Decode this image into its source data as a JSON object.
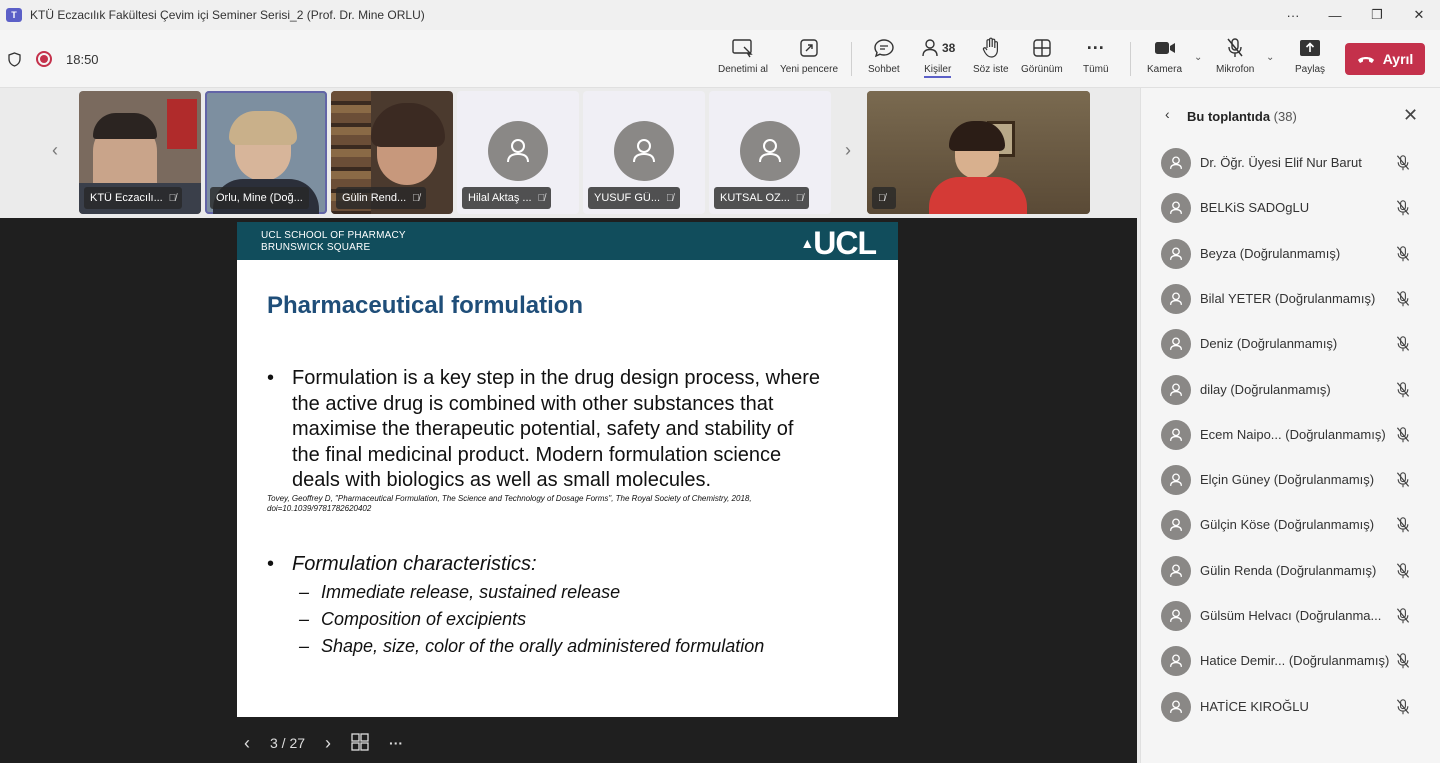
{
  "window": {
    "app_icon_text": "T",
    "title": "KTÜ Eczacılık Fakültesi Çevim içi Seminer Serisi_2 (Prof. Dr. Mine ORLU)",
    "controls": [
      "···",
      "—",
      "❐",
      "✕"
    ]
  },
  "toolbar": {
    "timer": "18:50",
    "buttons": [
      {
        "label": "Denetimi al",
        "icon": "take-control-icon"
      },
      {
        "label": "Yeni pencere",
        "icon": "pop-out-icon"
      },
      {
        "label": "Sohbet",
        "icon": "chat-icon"
      },
      {
        "label": "Kişiler",
        "icon": "people-icon",
        "count": "38"
      },
      {
        "label": "Söz iste",
        "icon": "raise-hand-icon"
      },
      {
        "label": "Görünüm",
        "icon": "view-icon"
      },
      {
        "label": "Tümü",
        "icon": "more-icon"
      },
      {
        "label": "Kamera",
        "icon": "camera-icon"
      },
      {
        "label": "Mikrofon",
        "icon": "mic-off-icon"
      },
      {
        "label": "Paylaş",
        "icon": "share-icon"
      }
    ],
    "leave_label": "Ayrıl"
  },
  "gallery": {
    "tiles": [
      {
        "name": "KTÜ Eczacılı...",
        "type": "video"
      },
      {
        "name": "Orlu, Mine (Doğ...",
        "type": "video"
      },
      {
        "name": "Gülin Rend...",
        "type": "video"
      },
      {
        "name": "Hilal Aktaş ...",
        "type": "avatar"
      },
      {
        "name": "YUSUF GÜ...",
        "type": "avatar"
      },
      {
        "name": "KUTSAL OZ...",
        "type": "avatar"
      }
    ]
  },
  "slide": {
    "institution_line1": "UCL SCHOOL OF PHARMACY",
    "institution_line2": "BRUNSWICK SQUARE",
    "logo": "UCL",
    "title": "Pharmaceutical formulation",
    "bullet1_lines": [
      "Formulation is a key step in the drug design process, where",
      "the active drug is combined with other substances that",
      "maximise the therapeutic potential, safety and stability of",
      "the final medicinal product. Modern formulation science",
      "deals with biologics as well as small molecules."
    ],
    "citation_line1": "Tovey, Geoffrey D, \"Pharmaceutical Formulation, The Science and Technology of Dosage Forms\", The Royal Society of Chemistry, 2018,",
    "citation_line2": "doi=10.1039/9781782620402",
    "bullet2": "Formulation characteristics:",
    "sub_bullets": [
      "Immediate release, sustained release",
      "Composition of excipients",
      "Shape, size, color of the orally administered formulation"
    ],
    "page_indicator": "3 / 27"
  },
  "panel": {
    "title": "Bu toplantıda",
    "count": "(38)",
    "participants": [
      "Dr. Öğr. Üyesi Elif Nur Barut",
      "BELKiS SADOgLU",
      "Beyza (Doğrulanmamış)",
      "Bilal YETER (Doğrulanmamış)",
      "Deniz (Doğrulanmamış)",
      "dilay (Doğrulanmamış)",
      "Ecem Naipo...   (Doğrulanmamış)",
      "Elçin Güney (Doğrulanmamış)",
      "Gülçin Köse (Doğrulanmamış)",
      "Gülin Renda (Doğrulanmamış)",
      "Gülsüm Helvacı (Doğrulanma...",
      "Hatice Demir... (Doğrulanmamış)",
      "HATİCE KIROĞLU"
    ]
  },
  "colors": {
    "leave": "#c4314b",
    "accent": "#5b5fc7",
    "slide_header": "#114d5c",
    "slide_title": "#1f4e79"
  }
}
